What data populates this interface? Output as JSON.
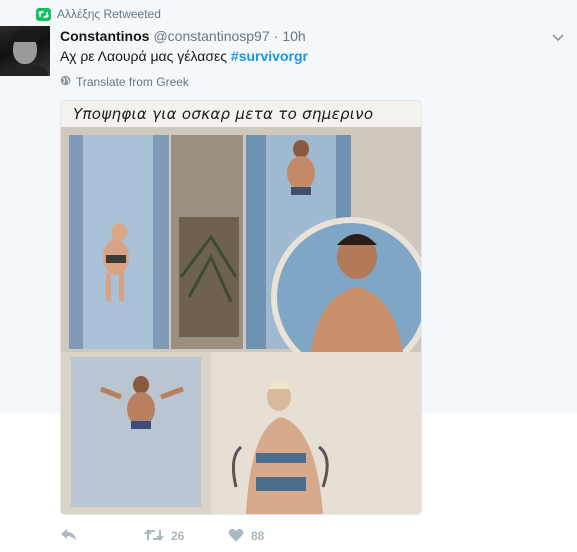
{
  "retweet": {
    "label": "Αλλέξης Retweeted",
    "icon": "retweet-icon",
    "badge_color": "#17bf63"
  },
  "tweet": {
    "display_name": "Constantinos",
    "handle": "@constantinosp97",
    "separator": "·",
    "time": "10h",
    "text": "Αχ ρε Λαουρά μας γέλασες ",
    "hashtag": "#survivorgr",
    "translate_label": "Translate from Greek",
    "translate_icon": "globe-icon",
    "more_icon": "chevron-down-icon"
  },
  "media": {
    "caption": "Υποψηφια για οσκαρ μετα το σημερινο"
  },
  "actions": {
    "reply_icon": "reply-icon",
    "retweet_icon": "retweet-icon",
    "retweet_count": "26",
    "like_icon": "heart-icon",
    "like_count": "88"
  },
  "colors": {
    "link": "#1b95e0",
    "muted": "#657786",
    "action": "#aab8c2",
    "header_bg": "#f5f8fa"
  }
}
